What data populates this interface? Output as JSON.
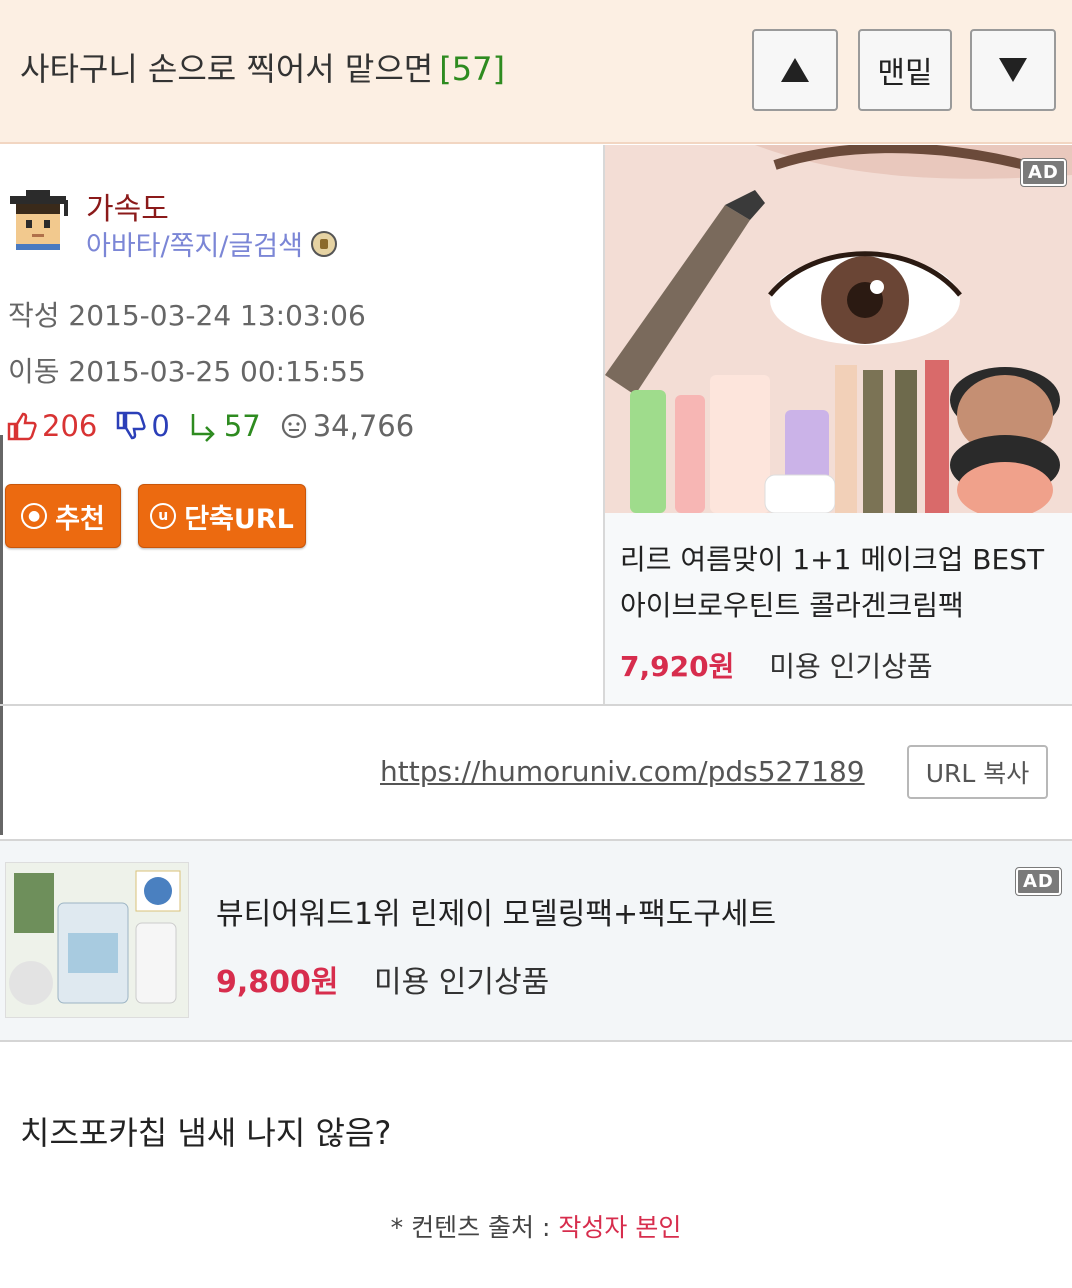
{
  "header": {
    "title": "사타구니 손으로 찍어서 맡으면",
    "comment_count": "[57]",
    "btn_bottom": "맨밑"
  },
  "author": {
    "name": "가속도",
    "links": "아바타/쪽지/글검색"
  },
  "meta": {
    "created": "작성 2015-03-24 13:03:06",
    "moved": "이동 2015-03-25 00:15:55"
  },
  "stats": {
    "likes": "206",
    "dislikes": "0",
    "replies": "57",
    "views": "34,766"
  },
  "actions": {
    "recommend": "추천",
    "short_url": "단축URL"
  },
  "ad1": {
    "tag": "AD",
    "title": "리르 여름맞이 1+1 메이크업 BEST 아이브로우틴트 콜라겐크림팩",
    "price": "7,920원",
    "category": "미용 인기상품"
  },
  "url": {
    "link": "https://humoruniv.com/pds527189",
    "copy_label": "URL 복사"
  },
  "ad2": {
    "tag": "AD",
    "title": "뷰티어워드1위 린제이 모델링팩+팩도구세트",
    "price": "9,800원",
    "category": "미용 인기상품"
  },
  "post": {
    "body": "치즈포카칩 냄새 나지 않음?",
    "source_label": "* 컨텐츠 출처 : ",
    "source_value": "작성자 본인"
  },
  "colors": {
    "header_bg": "#fcefe3",
    "accent_orange": "#ec6a10",
    "price_red": "#d72d4d",
    "count_green": "#2e8b20"
  }
}
